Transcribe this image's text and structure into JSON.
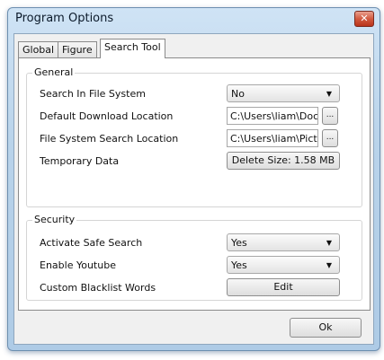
{
  "window": {
    "title": "Program Options",
    "close_glyph": "✕"
  },
  "tabs": [
    {
      "label": "Global",
      "active": false
    },
    {
      "label": "Figure",
      "active": false
    },
    {
      "label": "Search Tool",
      "active": true
    }
  ],
  "general": {
    "title": "General",
    "search_fs_label": "Search In File System",
    "search_fs_value": "No",
    "download_label": "Default Download Location",
    "download_value": "C:\\Users\\liam\\Doc",
    "fs_location_label": "File System Search Location",
    "fs_location_value": "C:\\Users\\liam\\Pictu",
    "browse_label": "...",
    "temp_label": "Temporary Data",
    "temp_button": "Delete Size: 1.58 MB"
  },
  "security": {
    "title": "Security",
    "safe_search_label": "Activate Safe Search",
    "safe_search_value": "Yes",
    "youtube_label": "Enable Youtube",
    "youtube_value": "Yes",
    "blacklist_label": "Custom Blacklist Words",
    "blacklist_button": "Edit"
  },
  "footer": {
    "ok_label": "Ok"
  },
  "icons": {
    "dropdown": "chevron-down-icon",
    "close": "close-icon"
  }
}
